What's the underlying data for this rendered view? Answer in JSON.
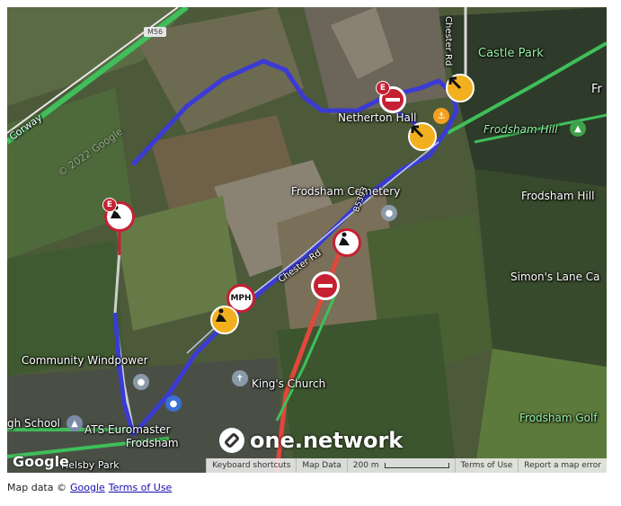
{
  "map": {
    "labels": {
      "motorway": "M56",
      "castle_park": "Castle Park",
      "chester_rd": "Chester Rd",
      "fr": "Fr",
      "netherton_hall": "Netherton Hall",
      "frodsham_hill_top": "Frodsham Hill",
      "corway": "Corway",
      "google_watermark": "© 2022 Google",
      "frodsham_cemetery": "Frodsham Cemetery",
      "frodsham_hill": "Frodsham Hill",
      "road_b5393": "B5393",
      "simons_lane": "Simon's Lane Ca",
      "chester_rd_2": "Chester Rd",
      "community_windpower": "Community Windpower",
      "kings_church": "King's Church",
      "high_school": "gh School",
      "ats_euromaster": "ATS Euromaster",
      "frodsham": "Frodsham",
      "frodsham_golf": "Frodsham Golf",
      "helsby_park": "Helsby Park"
    },
    "markers": {
      "e_label": "E",
      "mph_label": "MPH"
    },
    "branding": {
      "google": "Google",
      "one_network": "one.network"
    },
    "attribution_bar": {
      "keyboard_shortcuts": "Keyboard shortcuts",
      "map_data": "Map Data",
      "scale": "200 m",
      "terms": "Terms of Use",
      "report": "Report a map error"
    },
    "colors": {
      "route": "#3b3bd4",
      "traffic_red": "#e0473b",
      "traffic_green": "#3fbf5a",
      "marker_red": "#c62033",
      "marker_orange": "#f2b01e"
    }
  },
  "footer": {
    "prefix": "Map data ©",
    "google_link": "Google",
    "terms_link": "Terms of Use"
  }
}
